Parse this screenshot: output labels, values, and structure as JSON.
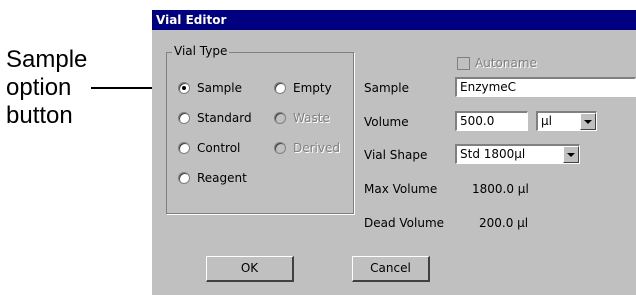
{
  "callout": {
    "line1": "Sample",
    "line2": "option",
    "line3": "button"
  },
  "dialog": {
    "title": "Vial Editor"
  },
  "vial_type": {
    "legend": "Vial Type",
    "options": [
      {
        "label": "Sample",
        "selected": true,
        "enabled": true
      },
      {
        "label": "Empty",
        "selected": false,
        "enabled": true
      },
      {
        "label": "Standard",
        "selected": false,
        "enabled": true
      },
      {
        "label": "Waste",
        "selected": false,
        "enabled": false
      },
      {
        "label": "Control",
        "selected": false,
        "enabled": true
      },
      {
        "label": "Derived",
        "selected": false,
        "enabled": false
      },
      {
        "label": "Reagent",
        "selected": false,
        "enabled": true
      }
    ]
  },
  "autoname": {
    "label": "Autoname",
    "checked": false,
    "enabled": false
  },
  "fields": {
    "sample_label": "Sample",
    "sample_value": "EnzymeC",
    "volume_label": "Volume",
    "volume_value": "500.0",
    "volume_unit": "µl",
    "vial_shape_label": "Vial Shape",
    "vial_shape_value": "Std 1800µl",
    "max_volume_label": "Max Volume",
    "max_volume_value": "1800.0 µl",
    "dead_volume_label": "Dead Volume",
    "dead_volume_value": "200.0 µl"
  },
  "buttons": {
    "ok": "OK",
    "cancel": "Cancel"
  },
  "colors": {
    "titlebar": "#000080",
    "dialog_bg": "#c0c0c0"
  }
}
